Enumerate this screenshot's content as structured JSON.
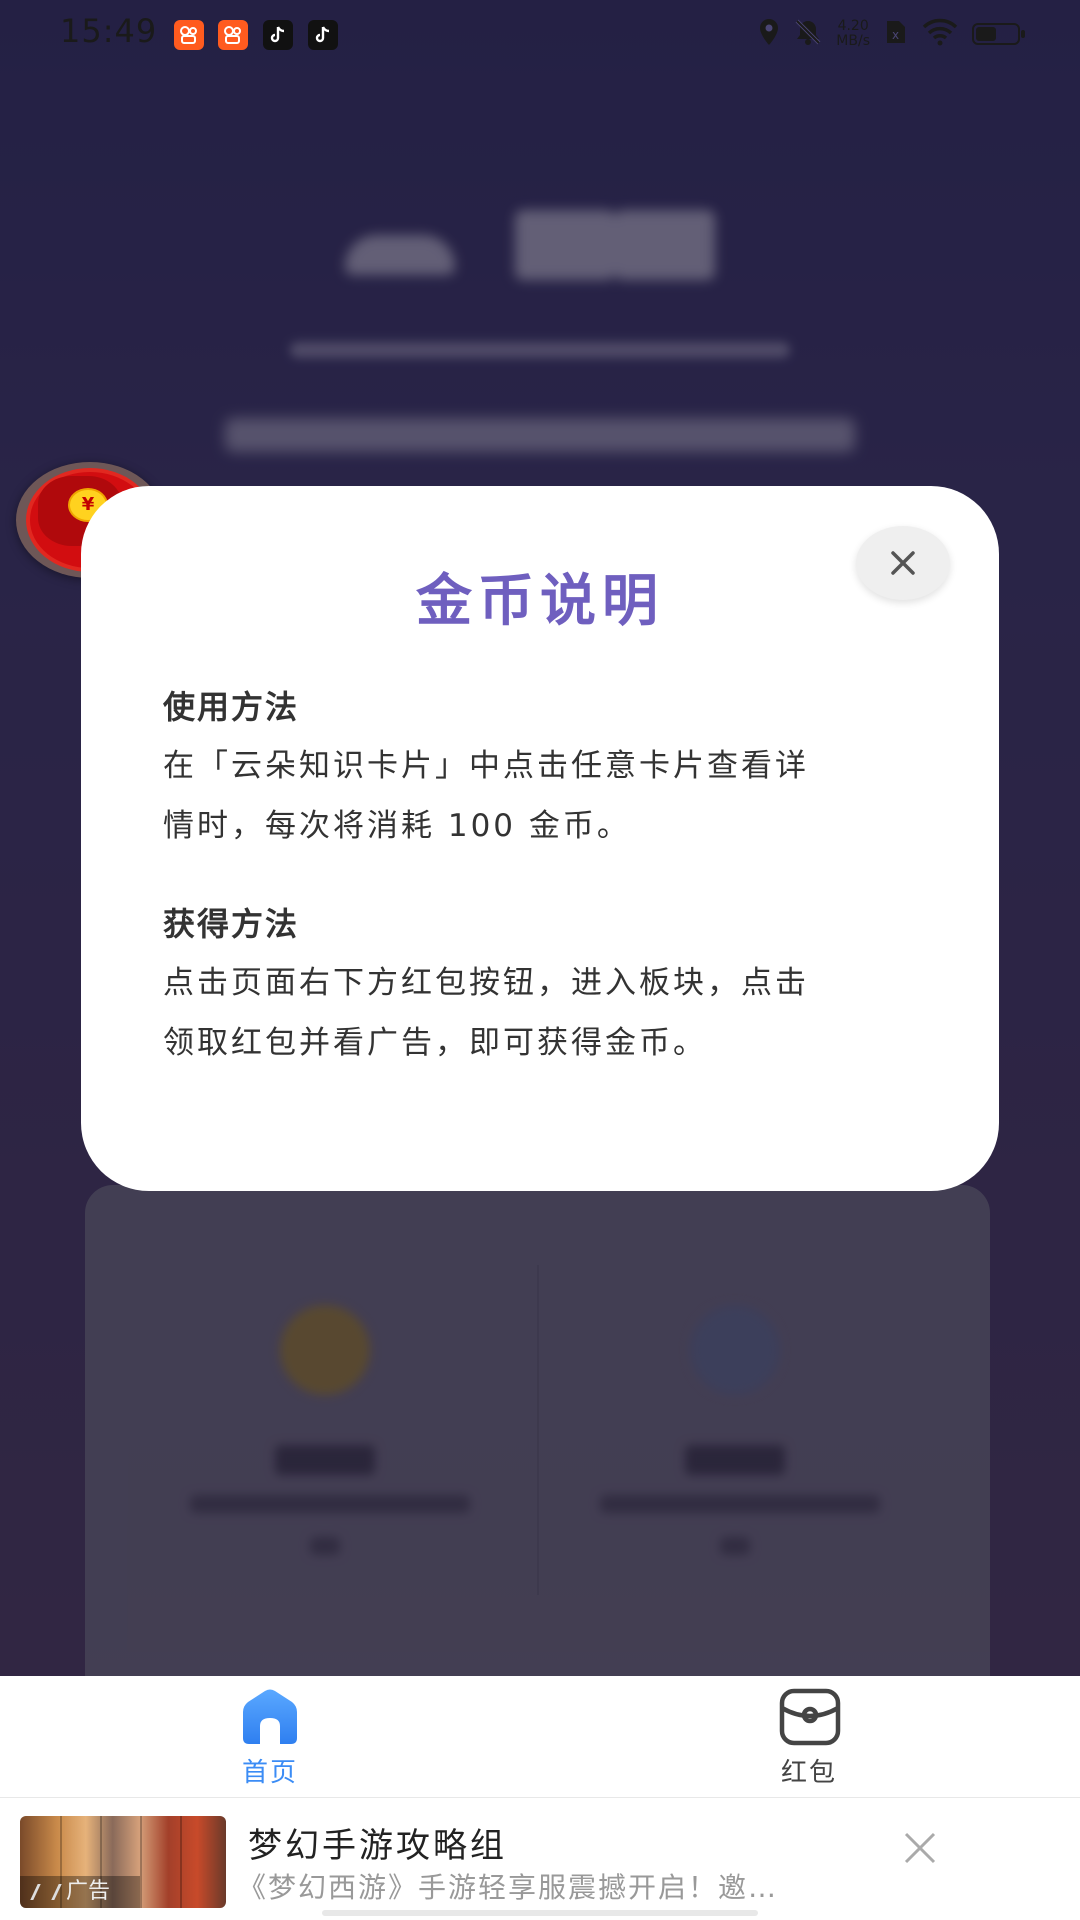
{
  "status_bar": {
    "time": "15:49",
    "network_speed_value": "4.20",
    "network_speed_unit": "MB/s",
    "battery_level": 0.45
  },
  "modal": {
    "title": "金币说明",
    "sections": [
      {
        "heading": "使用方法",
        "line1": "在「云朵知识卡片」中点击任意卡片查看详",
        "line2": "情时，每次将消耗 100 金币。"
      },
      {
        "heading": "获得方法",
        "line1": "点击页面右下方红包按钮，进入板块，点击",
        "line2": "领取红包并看广告，即可获得金币。"
      }
    ]
  },
  "red_packet": {
    "symbol": "¥"
  },
  "bottom_nav": {
    "items": [
      {
        "label": "首页",
        "active": true,
        "icon": "home-icon"
      },
      {
        "label": "红包",
        "active": false,
        "icon": "red-packet-icon"
      }
    ],
    "active_color": "#3b8cf5",
    "inactive_color": "#444444"
  },
  "ad": {
    "tag": "广告",
    "title": "梦幻手游攻略组",
    "description": "《梦幻西游》手游轻享服震撼开启！邀…"
  },
  "colors": {
    "title_purple": "#6f5fbf",
    "red": "#d20d10",
    "nav_blue": "#3b8cf5"
  }
}
